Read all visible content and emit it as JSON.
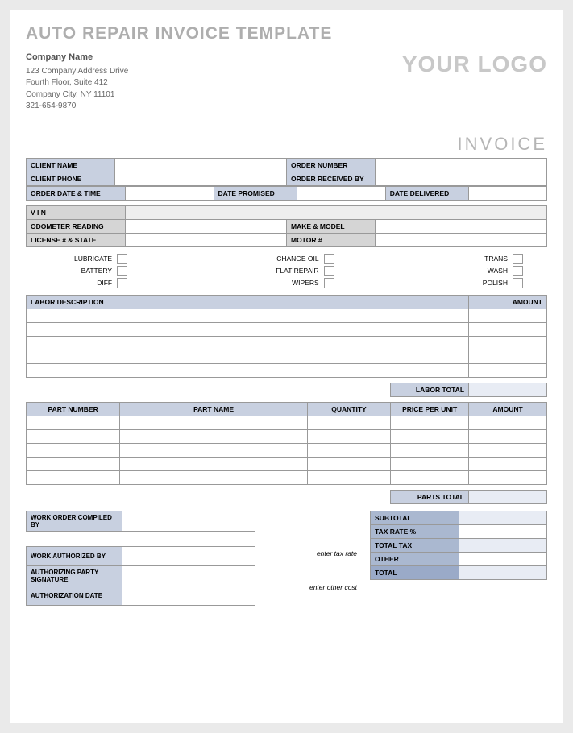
{
  "title": "AUTO REPAIR INVOICE TEMPLATE",
  "company": {
    "name": "Company Name",
    "addr1": "123 Company Address Drive",
    "addr2": "Fourth Floor, Suite 412",
    "addr3": "Company City, NY  11101",
    "phone": "321-654-9870"
  },
  "logo": "YOUR LOGO",
  "invoice_label": "INVOICE",
  "order": {
    "client_name": "CLIENT NAME",
    "client_phone": "CLIENT PHONE",
    "order_number": "ORDER NUMBER",
    "order_received_by": "ORDER RECEIVED BY",
    "order_date_time": "ORDER DATE & TIME",
    "date_promised": "DATE PROMISED",
    "date_delivered": "DATE DELIVERED"
  },
  "vehicle": {
    "vin": "V I N",
    "odometer": "ODOMETER READING",
    "make_model": "MAKE & MODEL",
    "license": "LICENSE # & STATE",
    "motor": "MOTOR #"
  },
  "services": {
    "col1": [
      "LUBRICATE",
      "BATTERY",
      "DIFF"
    ],
    "col2": [
      "CHANGE OIL",
      "FLAT REPAIR",
      "WIPERS"
    ],
    "col3": [
      "TRANS",
      "WASH",
      "POLISH"
    ]
  },
  "labor": {
    "desc_hdr": "LABOR DESCRIPTION",
    "amount_hdr": "AMOUNT",
    "total_lbl": "LABOR TOTAL"
  },
  "parts": {
    "number": "PART NUMBER",
    "name": "PART NAME",
    "qty": "QUANTITY",
    "ppu": "PRICE PER UNIT",
    "amount": "AMOUNT",
    "total_lbl": "PARTS TOTAL"
  },
  "work_order": {
    "compiled_by": "WORK ORDER COMPILED BY",
    "authorized_by": "WORK AUTHORIZED BY",
    "signature": "AUTHORIZING PARTY SIGNATURE",
    "auth_date": "AUTHORIZATION DATE"
  },
  "totals": {
    "subtotal": "SUBTOTAL",
    "tax_rate": "TAX RATE %",
    "total_tax": "TOTAL TAX",
    "other": "OTHER",
    "total": "TOTAL",
    "enter_tax": "enter tax rate",
    "enter_other": "enter other cost"
  }
}
